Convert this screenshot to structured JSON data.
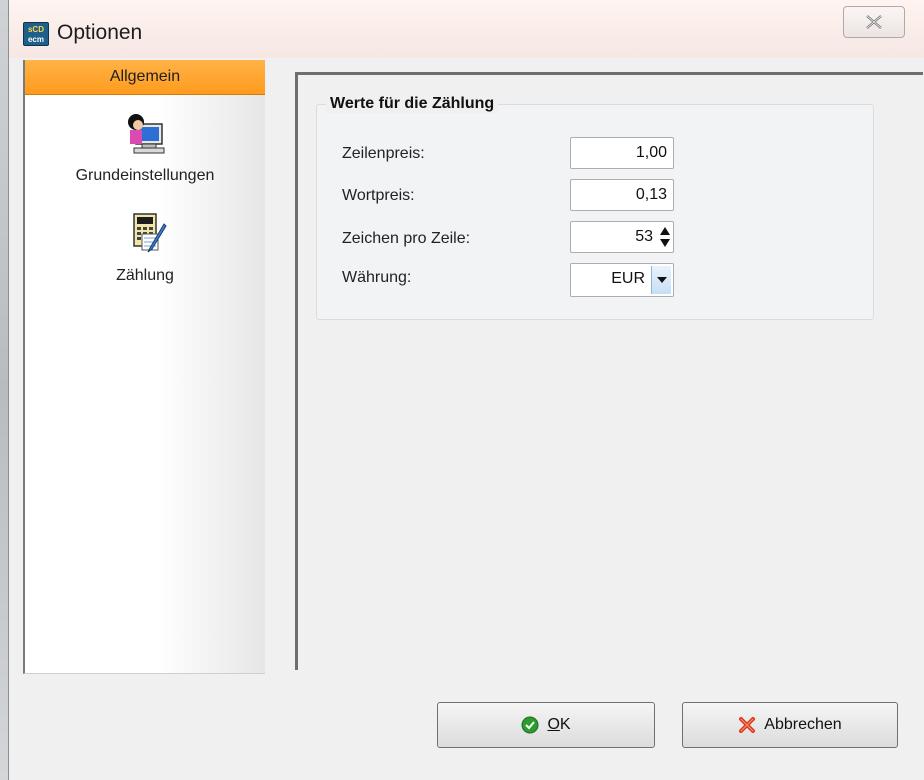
{
  "window": {
    "title": "Optionen",
    "app_icon_text": [
      "sCD",
      "ecm"
    ]
  },
  "nav": {
    "header": "Allgemein",
    "items": [
      {
        "label": "Grundeinstellungen",
        "icon": "user-computer-icon"
      },
      {
        "label": "Zählung",
        "icon": "calculator-pen-icon"
      }
    ]
  },
  "group": {
    "title": "Werte für die Zählung",
    "fields": {
      "zeilenpreis": {
        "label": "Zeilenpreis:",
        "value": "1,00"
      },
      "wortpreis": {
        "label": "Wortpreis:",
        "value": "0,13"
      },
      "zeichen": {
        "label": "Zeichen pro Zeile:",
        "value": "53"
      },
      "waehrung": {
        "label": "Währung:",
        "value": "EUR"
      }
    }
  },
  "buttons": {
    "ok": {
      "label_ul": "O",
      "label_rest": "K"
    },
    "cancel": {
      "label": "Abbrechen"
    }
  },
  "colors": {
    "nav_header": "#ff9b1e",
    "ok_icon": "#2e9b2e",
    "cancel_icon": "#d63a1e"
  }
}
